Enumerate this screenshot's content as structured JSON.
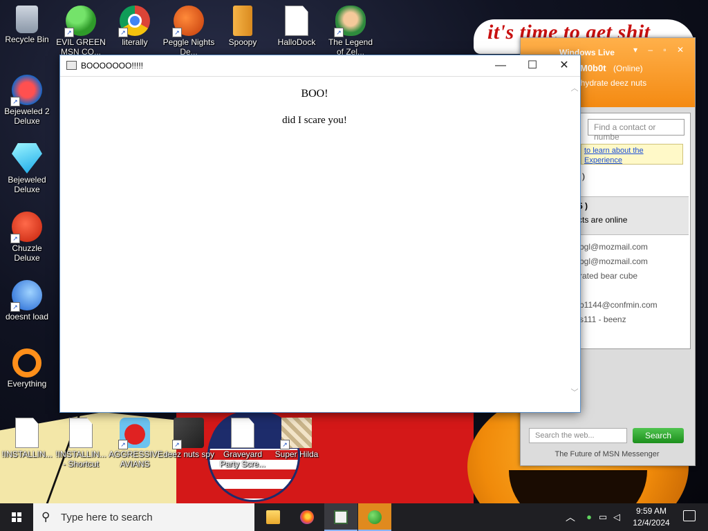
{
  "wallpaper": {
    "headline": "it's time to get shit"
  },
  "desktop_icons": [
    {
      "label": "Recycle Bin",
      "icon": "recycle-bin-icon"
    },
    {
      "label": "EVIL GREEN MSN CO...",
      "icon": "msn-icon"
    },
    {
      "label": "literally",
      "icon": "chrome-icon"
    },
    {
      "label": "Peggle Nights De...",
      "icon": "peggle-icon"
    },
    {
      "label": "Spoopy",
      "icon": "spoopy-icon"
    },
    {
      "label": "HalloDock",
      "icon": "document-icon"
    },
    {
      "label": "The Legend of Zel...",
      "icon": "zelda-icon"
    },
    {
      "label": "Bejeweled 2 Deluxe",
      "icon": "bejeweled2-icon"
    },
    {
      "label": "Bejeweled Deluxe",
      "icon": "gem-icon"
    },
    {
      "label": "Chuzzle Deluxe",
      "icon": "chuzzle-icon"
    },
    {
      "label": "doesnt load",
      "icon": "thunderbird-icon"
    },
    {
      "label": "Everything",
      "icon": "everything-icon"
    },
    {
      "label": "!INSTALLIN...",
      "icon": "document-icon"
    },
    {
      "label": "!INSTALLIN... - Shortcut",
      "icon": "document-icon"
    },
    {
      "label": "AGGRESSIVE AVIANS",
      "icon": "angry-birds-icon"
    },
    {
      "label": "deez nuts spy",
      "icon": "spy-icon"
    },
    {
      "label": "Graveyard Party Scre...",
      "icon": "document-icon"
    },
    {
      "label": "Super Hilda",
      "icon": "hilda-icon"
    }
  ],
  "msn": {
    "title": "Windows Live",
    "user": "M0b0t",
    "status": "(Online)",
    "personal_message": "ehydrate deez nuts",
    "find_placeholder": "Find a contact or numbe",
    "banner_line1": "to learn about the",
    "banner_line2": "Experience",
    "paren": ")",
    "group_header": "5 )",
    "group_subtitle": "cts are online",
    "contacts": [
      "bgl@mozmail.com",
      "bgl@mozmail.com",
      "rated bear cube",
      "b1144@confmin.com",
      "s111 - beenz"
    ],
    "search_placeholder": "Search the web...",
    "search_button": "Search",
    "footer": "The Future of MSN Messenger"
  },
  "popup": {
    "title": "BOOOOOOO!!!!!",
    "heading": "BOO!",
    "message": "did I scare you!"
  },
  "taskbar": {
    "search_placeholder": "Type here to search",
    "time": "9:59 AM",
    "date": "12/4/2024"
  },
  "colors": {
    "msn_orange": "#f48a12",
    "search_green": "#1c8f1c",
    "taskbar": "#1f1f23",
    "window_border": "#5b8fc7"
  }
}
